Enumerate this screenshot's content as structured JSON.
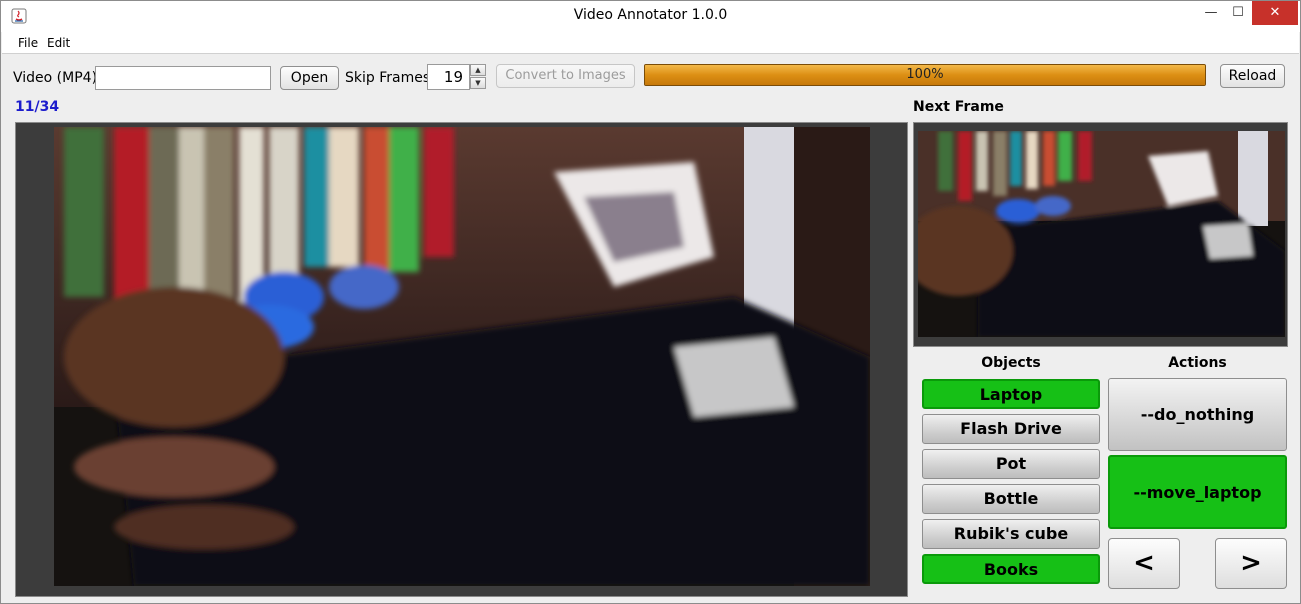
{
  "window": {
    "title": "Video Annotator 1.0.0",
    "min_glyph": "—",
    "max_glyph": "☐",
    "close_glyph": "✕"
  },
  "menu": [
    "File",
    "Edit"
  ],
  "toolbar": {
    "video_label": "Video (MP4)",
    "video_value": "",
    "open_label": "Open",
    "skip_label": "Skip Frames",
    "skip_value": "19",
    "convert_label": "Convert to Images",
    "progress_text": "100%",
    "progress_value": 1.0,
    "reload_label": "Reload"
  },
  "frame_counter": "11/34",
  "next_frame_label": "Next Frame",
  "objects": {
    "heading": "Objects",
    "items": [
      {
        "label": "Laptop",
        "selected": true
      },
      {
        "label": "Flash Drive",
        "selected": false
      },
      {
        "label": "Pot",
        "selected": false
      },
      {
        "label": "Bottle",
        "selected": false
      },
      {
        "label": "Rubik's cube",
        "selected": false
      },
      {
        "label": "Books",
        "selected": true
      }
    ]
  },
  "actions": {
    "heading": "Actions",
    "items": [
      {
        "label": "--do_nothing",
        "selected": false
      },
      {
        "label": "--move_laptop",
        "selected": true
      }
    ]
  },
  "nav": {
    "prev": "<",
    "next": ">"
  },
  "colors": {
    "selected_green": "#16c016",
    "progress_orange": "#dc8f14",
    "counter_blue": "#1c1ccc"
  }
}
